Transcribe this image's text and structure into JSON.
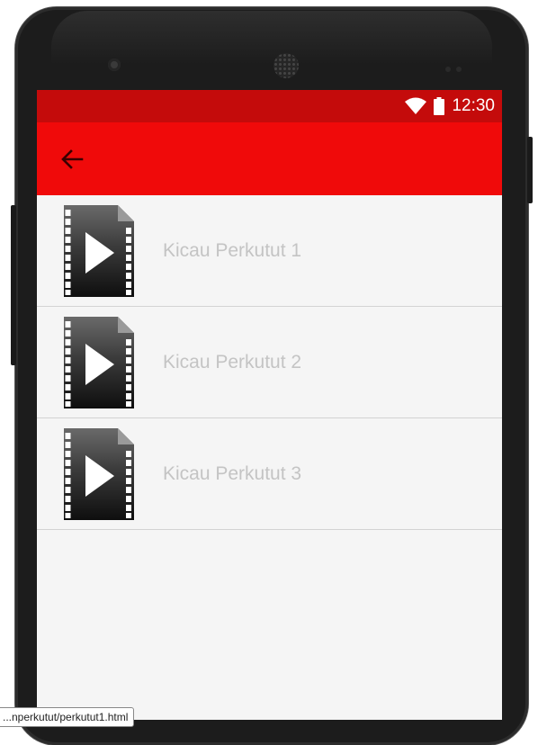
{
  "status_bar": {
    "time": "12:30",
    "wifi_icon": "wifi-icon",
    "battery_icon": "battery-icon"
  },
  "app_bar": {
    "back_icon": "arrow-back-icon",
    "background": "#f00a0a",
    "status_color": "#c40b0b"
  },
  "list": {
    "items": [
      {
        "label": "Kicau Perkutut 1",
        "icon": "video-file-icon"
      },
      {
        "label": "Kicau Perkutut 2",
        "icon": "video-file-icon"
      },
      {
        "label": "Kicau Perkutut 3",
        "icon": "video-file-icon"
      }
    ]
  },
  "tooltip": {
    "url": "...nperkutut/perkutut1.html"
  }
}
